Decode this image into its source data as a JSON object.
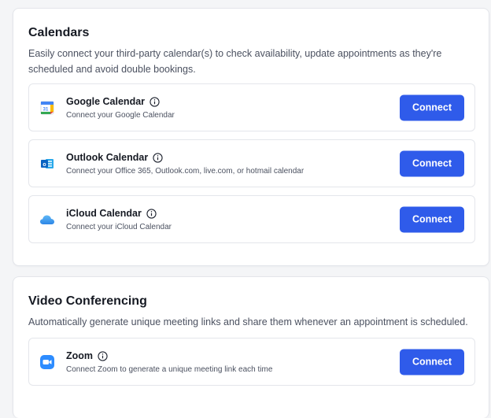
{
  "calendars": {
    "title": "Calendars",
    "description": "Easily connect your third-party calendar(s) to check availability, update appointments as they're scheduled and avoid double bookings.",
    "items": [
      {
        "name": "Google Calendar",
        "subtitle": "Connect your Google Calendar",
        "button": "Connect",
        "icon": "google-calendar-icon"
      },
      {
        "name": "Outlook Calendar",
        "subtitle": "Connect your Office 365, Outlook.com, live.com, or hotmail calendar",
        "button": "Connect",
        "icon": "outlook-icon"
      },
      {
        "name": "iCloud Calendar",
        "subtitle": "Connect your iCloud Calendar",
        "button": "Connect",
        "icon": "icloud-icon"
      }
    ]
  },
  "video": {
    "title": "Video Conferencing",
    "description": "Automatically generate unique meeting links and share them whenever an appointment is scheduled.",
    "items": [
      {
        "name": "Zoom",
        "subtitle": "Connect Zoom to generate a unique meeting link each time",
        "button": "Connect",
        "icon": "zoom-icon"
      }
    ]
  },
  "colors": {
    "primary": "#2f5bea",
    "border": "#e4e6eb",
    "text": "#161a23",
    "muted": "#4b5160"
  }
}
